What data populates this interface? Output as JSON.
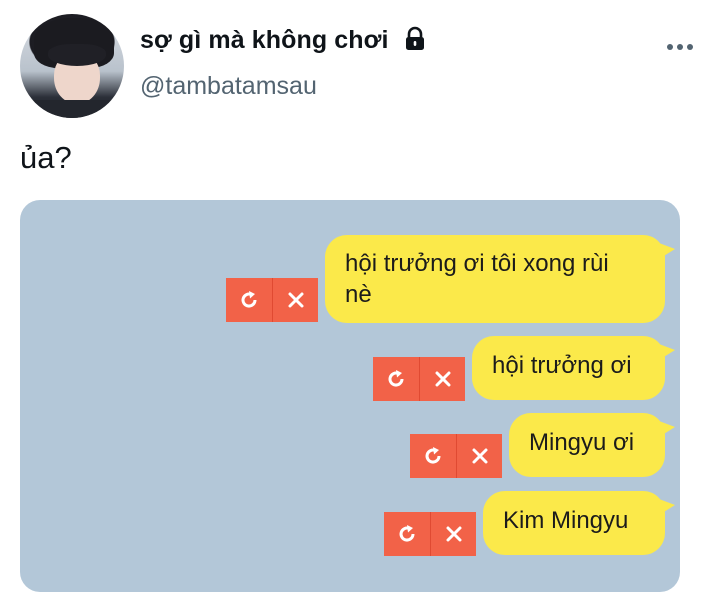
{
  "header": {
    "display_name": "sợ gì mà không chơi",
    "handle": "@tambatamsau"
  },
  "tweet": {
    "text": "ủa?"
  },
  "chat": {
    "colors": {
      "background": "#b3c7d8",
      "bubble": "#fbe94a",
      "action": "#f26248"
    },
    "messages": [
      {
        "lines": [
          "hội trưởng ơi tôi xong rùi",
          "nè"
        ]
      },
      {
        "lines": [
          "hội trưởng ơi"
        ]
      },
      {
        "lines": [
          "Mingyu ơi"
        ]
      },
      {
        "lines": [
          "Kim Mingyu"
        ]
      }
    ],
    "action_icons": [
      "retry-icon",
      "close-icon"
    ]
  },
  "icons": {
    "lock": "lock-icon",
    "more": "more-icon"
  }
}
